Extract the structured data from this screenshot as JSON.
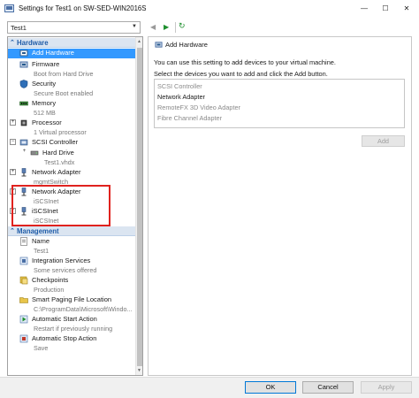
{
  "window": {
    "title": "Settings for Test1 on SW-SED-WIN2016S",
    "minimize_glyph": "—",
    "maximize_glyph": "☐",
    "close_glyph": "✕"
  },
  "toolbar": {
    "vm_selected": "Test1"
  },
  "hardware": {
    "section_label": "Hardware",
    "items": [
      {
        "label": "Add Hardware",
        "sub": "",
        "icon": "add-hardware-icon"
      },
      {
        "label": "Firmware",
        "sub": "Boot from Hard Drive",
        "icon": "firmware-icon"
      },
      {
        "label": "Security",
        "sub": "Secure Boot enabled",
        "icon": "security-icon"
      },
      {
        "label": "Memory",
        "sub": "512 MB",
        "icon": "memory-icon"
      },
      {
        "label": "Processor",
        "sub": "1 Virtual processor",
        "icon": "processor-icon"
      },
      {
        "label": "SCSI Controller",
        "sub": "",
        "icon": "scsi-controller-icon"
      },
      {
        "label": "Hard Drive",
        "sub": "Test1.vhdx",
        "icon": "hard-drive-icon"
      },
      {
        "label": "Network Adapter",
        "sub": "mgmtSwitch",
        "icon": "network-adapter-icon"
      },
      {
        "label": "Network Adapter",
        "sub": "iSCSInet",
        "icon": "network-adapter-icon"
      },
      {
        "label": "iSCSInet",
        "sub": "iSCSInet",
        "icon": "network-adapter-icon"
      }
    ]
  },
  "management": {
    "section_label": "Management",
    "items": [
      {
        "label": "Name",
        "sub": "Test1",
        "icon": "name-icon"
      },
      {
        "label": "Integration Services",
        "sub": "Some services offered",
        "icon": "integration-services-icon"
      },
      {
        "label": "Checkpoints",
        "sub": "Production",
        "icon": "checkpoints-icon"
      },
      {
        "label": "Smart Paging File Location",
        "sub": "C:\\ProgramData\\Microsoft\\Windo...",
        "icon": "folder-icon"
      },
      {
        "label": "Automatic Start Action",
        "sub": "Restart if previously running",
        "icon": "start-action-icon"
      },
      {
        "label": "Automatic Stop Action",
        "sub": "Save",
        "icon": "stop-action-icon"
      }
    ]
  },
  "add_hardware": {
    "heading": "Add Hardware",
    "description": "You can use this setting to add devices to your virtual machine.",
    "instruction": "Select the devices you want to add and click the Add button.",
    "devices": [
      {
        "label": "SCSI Controller",
        "enabled": false
      },
      {
        "label": "Network Adapter",
        "enabled": true
      },
      {
        "label": "RemoteFX 3D Video Adapter",
        "enabled": false
      },
      {
        "label": "Fibre Channel Adapter",
        "enabled": false
      }
    ],
    "add_button": "Add"
  },
  "footer": {
    "ok": "OK",
    "cancel": "Cancel",
    "apply": "Apply"
  },
  "colors": {
    "selection": "#3399ff",
    "section_header": "#dbe5f1",
    "section_text": "#1f5ca8",
    "highlight": "#e0221e",
    "toolbar_green": "#1e8f2e"
  }
}
